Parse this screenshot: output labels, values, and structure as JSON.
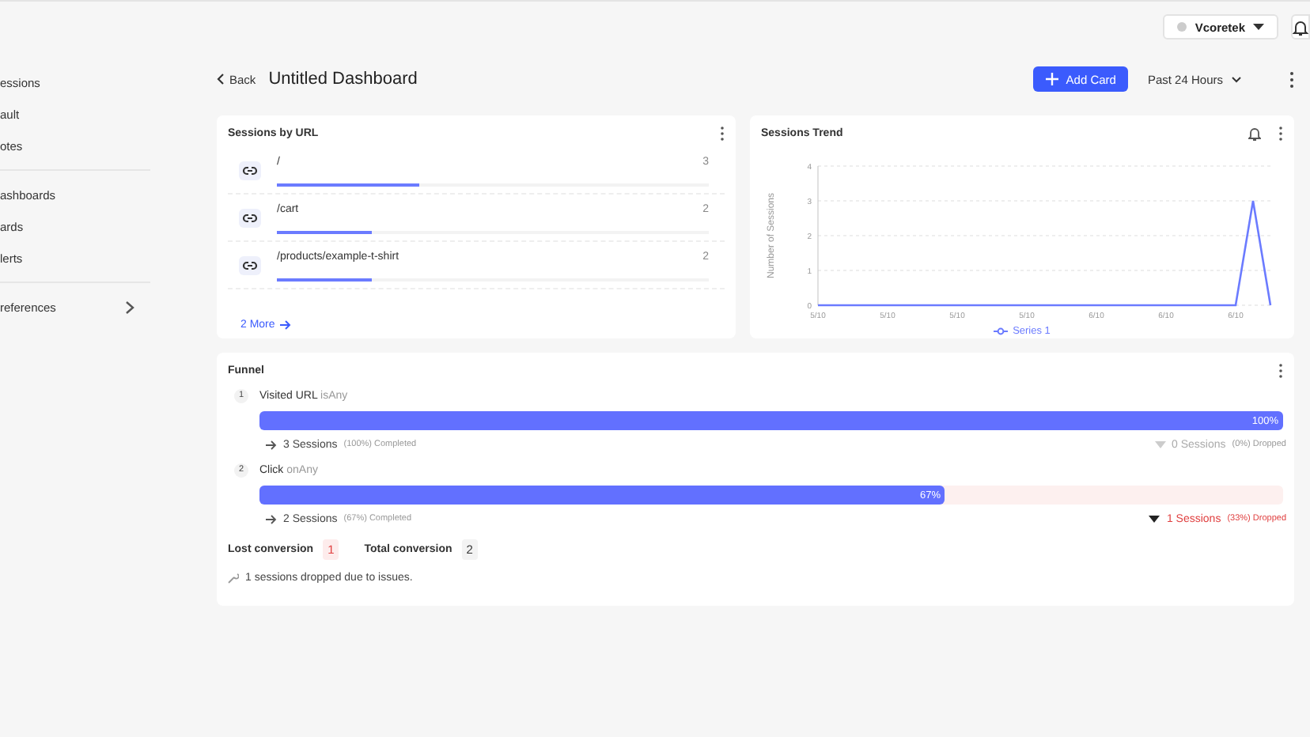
{
  "sidebar": {
    "groups": [
      {
        "items": [
          {
            "label": "essions"
          },
          {
            "label": "ault"
          },
          {
            "label": "otes"
          }
        ]
      },
      {
        "items": [
          {
            "label": "ashboards"
          },
          {
            "label": "ards"
          },
          {
            "label": "lerts"
          }
        ]
      },
      {
        "items": [
          {
            "label": "references",
            "expandable": true
          }
        ]
      }
    ]
  },
  "topbar": {
    "account": "Vcoretek"
  },
  "header": {
    "back": "Back",
    "title": "Untitled Dashboard",
    "add_card": "Add Card",
    "period": "Past 24 Hours"
  },
  "sessions_by_url": {
    "title": "Sessions by URL",
    "rows": [
      {
        "url": "/",
        "count": "3",
        "level": 0.33
      },
      {
        "url": "/cart",
        "count": "2",
        "level": 0.22
      },
      {
        "url": "/products/example-t-shirt",
        "count": "2",
        "level": 0.22
      }
    ],
    "more": "2 More"
  },
  "sessions_trend": {
    "title": "Sessions Trend",
    "chart_data": {
      "type": "line",
      "ylabel": "Number of Sessions",
      "categories": [
        "5/10",
        null,
        null,
        null,
        "5/10",
        null,
        null,
        null,
        "5/10",
        null,
        null,
        null,
        "5/10",
        null,
        null,
        null,
        "6/10",
        null,
        null,
        null,
        "6/10",
        null,
        null,
        null,
        "6/10",
        null,
        null
      ],
      "series": [
        {
          "name": "Series 1",
          "color": "#6b7bff",
          "values": [
            0,
            0,
            0,
            0,
            0,
            0,
            0,
            0,
            0,
            0,
            0,
            0,
            0,
            0,
            0,
            0,
            0,
            0,
            0,
            0,
            0,
            0,
            0,
            0,
            0,
            3,
            0
          ]
        }
      ],
      "ylim": [
        0,
        4
      ],
      "yticks": [
        0,
        1,
        2,
        3,
        4
      ],
      "grid": true
    }
  },
  "funnel": {
    "title": "Funnel",
    "steps": [
      {
        "number": "1",
        "event": "Visited URL",
        "operator": "isAny",
        "level": 1,
        "percent": "100%",
        "completed": "3 Sessions",
        "completed_pct": "(100%) Completed",
        "dropped": false,
        "dropped_count": "0 Sessions",
        "dropped_pct": "(0%) Dropped"
      },
      {
        "number": "2",
        "event": "Click",
        "operator": "onAny",
        "level": 0.67,
        "percent": "67%",
        "completed": "2 Sessions",
        "completed_pct": "(67%) Completed",
        "dropped": true,
        "dropped_count": "1 Sessions",
        "dropped_pct": "(33%) Dropped"
      }
    ],
    "lost_label": "Lost conversion",
    "lost_value": "1",
    "total_label": "Total conversion",
    "total_value": "2",
    "issues": "1 sessions dropped due to issues."
  }
}
